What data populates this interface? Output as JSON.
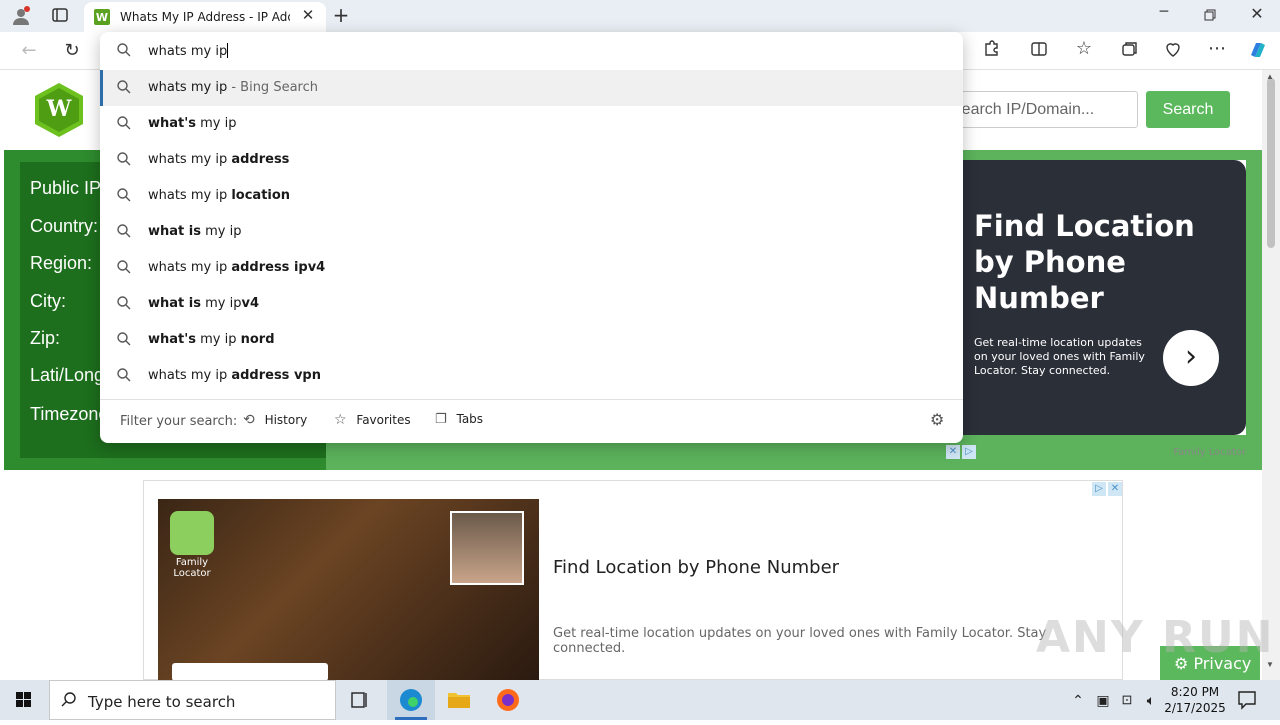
{
  "browser": {
    "tab_title": "Whats My IP Address - IP Address",
    "favicon_letter": "W",
    "address_text": "whats my ip"
  },
  "site": {
    "logo_letter": "W",
    "search_placeholder": "Search IP/Domain...",
    "search_button": "Search",
    "info_labels": [
      "Public IP",
      "Country:",
      "Region:",
      "City:",
      "Zip:",
      "Lati/Long",
      "Timezone"
    ],
    "ad_card": {
      "headline": "Find Location by Phone Number",
      "subtext": "Get real-time location updates on your loved ones with Family Locator. Stay connected.",
      "brand": "Family Locator"
    },
    "ad_banner": {
      "title": "Find Location by Phone Number",
      "description": "Get real-time location updates on your loved ones with Family Locator. Stay connected.",
      "badge_line1": "Family",
      "badge_line2": "Locator"
    },
    "privacy_label": "Privacy"
  },
  "omnibox": {
    "suggestions": [
      {
        "parts": [
          {
            "t": "whats my ip",
            "b": false
          }
        ],
        "suffix": " - Bing Search"
      },
      {
        "parts": [
          {
            "t": "what's",
            "b": true
          },
          {
            "t": " my ip",
            "b": false
          }
        ]
      },
      {
        "parts": [
          {
            "t": "whats my ip ",
            "b": false
          },
          {
            "t": "address",
            "b": true
          }
        ]
      },
      {
        "parts": [
          {
            "t": "whats my ip ",
            "b": false
          },
          {
            "t": "location",
            "b": true
          }
        ]
      },
      {
        "parts": [
          {
            "t": "what is",
            "b": true
          },
          {
            "t": " my ip",
            "b": false
          }
        ]
      },
      {
        "parts": [
          {
            "t": "whats my ip ",
            "b": false
          },
          {
            "t": "address ipv4",
            "b": true
          }
        ]
      },
      {
        "parts": [
          {
            "t": "what is",
            "b": true
          },
          {
            "t": " my ip",
            "b": false
          },
          {
            "t": "v4",
            "b": true
          }
        ]
      },
      {
        "parts": [
          {
            "t": "what's",
            "b": true
          },
          {
            "t": " my ip ",
            "b": false
          },
          {
            "t": "nord",
            "b": true
          }
        ]
      },
      {
        "parts": [
          {
            "t": "whats my ip ",
            "b": false
          },
          {
            "t": "address vpn",
            "b": true
          }
        ]
      }
    ],
    "filter_label": "Filter your search:",
    "filters": [
      "History",
      "Favorites",
      "Tabs"
    ]
  },
  "taskbar": {
    "search_placeholder": "Type here to search",
    "time": "8:20 PM",
    "date": "2/17/2025"
  },
  "watermark": "ANY RUN"
}
